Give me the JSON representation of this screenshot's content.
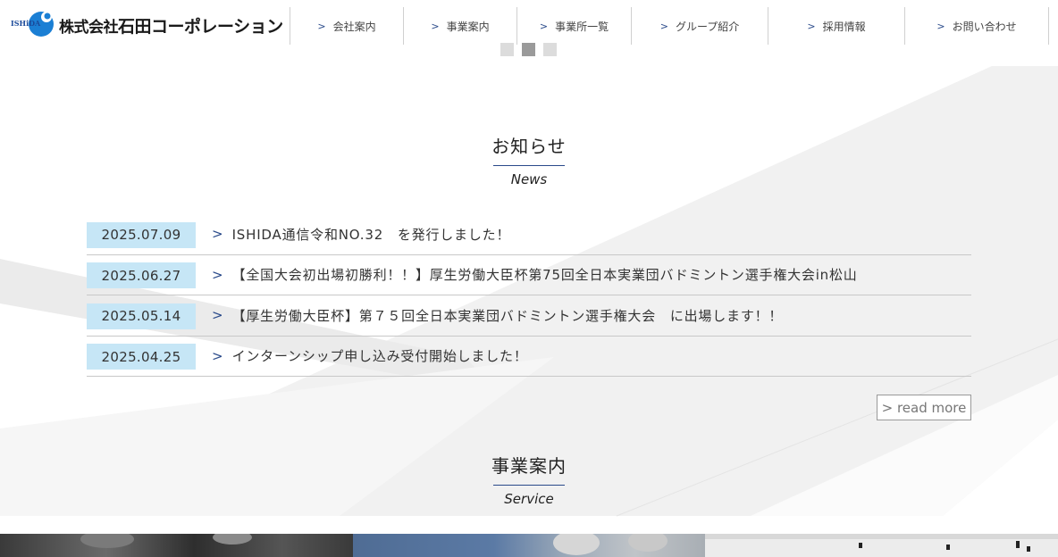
{
  "company": {
    "logo_small_text": "ISHiDA",
    "name_prefix": "株式会社",
    "name_main": "石田コーポレーション"
  },
  "nav": [
    {
      "label": "会社案内",
      "icon": "chevron-right-icon"
    },
    {
      "label": "事業案内",
      "icon": "chevron-right-icon"
    },
    {
      "label": "事業所一覧",
      "icon": "chevron-right-icon"
    },
    {
      "label": "グループ紹介",
      "icon": "chevron-right-icon"
    },
    {
      "label": "採用情報",
      "icon": "chevron-right-icon"
    },
    {
      "label": "お問い合わせ",
      "icon": "chevron-right-icon"
    }
  ],
  "slider": {
    "count": 3,
    "active_index": 1
  },
  "news_section": {
    "title": "お知らせ",
    "subtitle": "News",
    "items": [
      {
        "date": "2025.07.09",
        "text": "ISHIDA通信令和NO.32　を発行しました！"
      },
      {
        "date": "2025.06.27",
        "text": "【全国大会初出場初勝利！！】厚生労働大臣杯第75回全日本実業団バドミントン選手権大会in松山"
      },
      {
        "date": "2025.05.14",
        "text": "【厚生労働大臣杯】第７５回全日本実業団バドミントン選手権大会　に出場します！！"
      },
      {
        "date": "2025.04.25",
        "text": "インターンシップ申し込み受付開始しました！"
      }
    ],
    "read_more": "> read more"
  },
  "service_section": {
    "title": "事業案内",
    "subtitle": "Service"
  },
  "colors": {
    "accent": "#2a4a8a",
    "date_bg": "#c6e6f6",
    "logo_blue": "#1b7fd4"
  }
}
